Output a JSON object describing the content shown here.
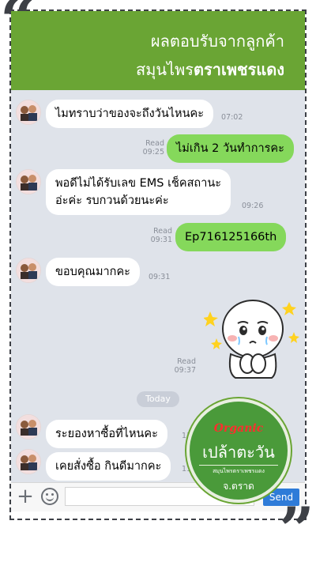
{
  "header": {
    "line1": "ผลตอบรับจากลูกค้า",
    "line2_a": "สมุนไพร",
    "line2_b": "ตราเพชรแดง"
  },
  "messages": [
    {
      "dir": "in",
      "text": "ไมทราบว่าของจะถึงวันไหนคะ",
      "time": "07:02"
    },
    {
      "dir": "out",
      "text": "ไม่เกิน 2 วันทำการคะ",
      "status": "Read",
      "time": "09:25"
    },
    {
      "dir": "in",
      "line1": "พอดีไม่ได้รับเลข EMS เช็คสถานะ",
      "line2": "อ่ะค่ะ รบกวนด้วยนะค่ะ",
      "time": "09:26"
    },
    {
      "dir": "out",
      "text": "Ep716125166th",
      "status": "Read",
      "time": "09:31"
    },
    {
      "dir": "in",
      "text": "ขอบคุณมากคะ",
      "time": "09:31"
    },
    {
      "dir": "out",
      "sticker": "crying-thankful-sticker",
      "status": "Read",
      "time": "09:37"
    },
    {
      "dir": "in",
      "text": "ระยองหาซื้อที่ไหนคะ",
      "time": "11:4"
    },
    {
      "dir": "in",
      "text": "เคยสั่งซื้อ กินดีมากคะ",
      "time": "11:4"
    }
  ],
  "date_divider": "Today",
  "input": {
    "placeholder": "",
    "send_label": "Send"
  },
  "badge": {
    "organic": "Organic",
    "name": "เปล้าตะวัน",
    "sub": "สมุนไพรตราเพชรแดง",
    "province": "จ.ตราด"
  },
  "colors": {
    "header": "#6aa534",
    "chat_bg": "#dfe3ea",
    "out_bubble": "#85d85b",
    "send": "#2e7bd8"
  }
}
